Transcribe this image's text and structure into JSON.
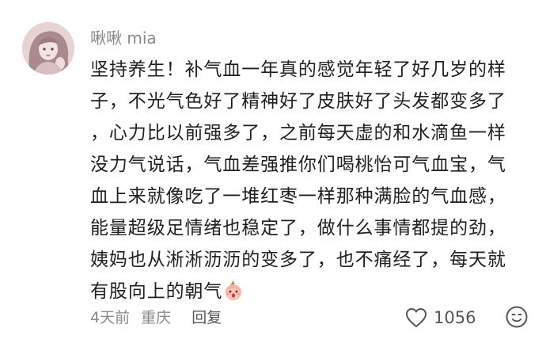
{
  "comment": {
    "username": "啾啾 mia",
    "lines": [
      "坚持养生！补气血一年真的感觉年轻了好几岁的样",
      "子，不光气色好了精神好了皮肤好了头发都变多了",
      "，心力比以前强多了，之前每天虚的和水滴鱼一样",
      "没力气说话，气血差强推你们喝桃怡可气血宝，气",
      "血上来就像吃了一堆红枣一样那种满脸的气血感，",
      "能量超级足情绪也稳定了，做什么事情都提的劲，",
      "姨妈也从淅淅沥沥的变多了，也不痛经了，每天就",
      "有股向上的朝气"
    ],
    "emoji": "peach-face-emoji",
    "time": "4天前",
    "location": "重庆",
    "reply_label": "回复",
    "like_count": "1056"
  },
  "icons": {
    "like": "heart-outline-icon",
    "react": "smiley-face-icon"
  },
  "colors": {
    "text": "#1f1f1f",
    "muted": "#8a8a8a",
    "username": "#888888",
    "background": "#ffffff"
  }
}
